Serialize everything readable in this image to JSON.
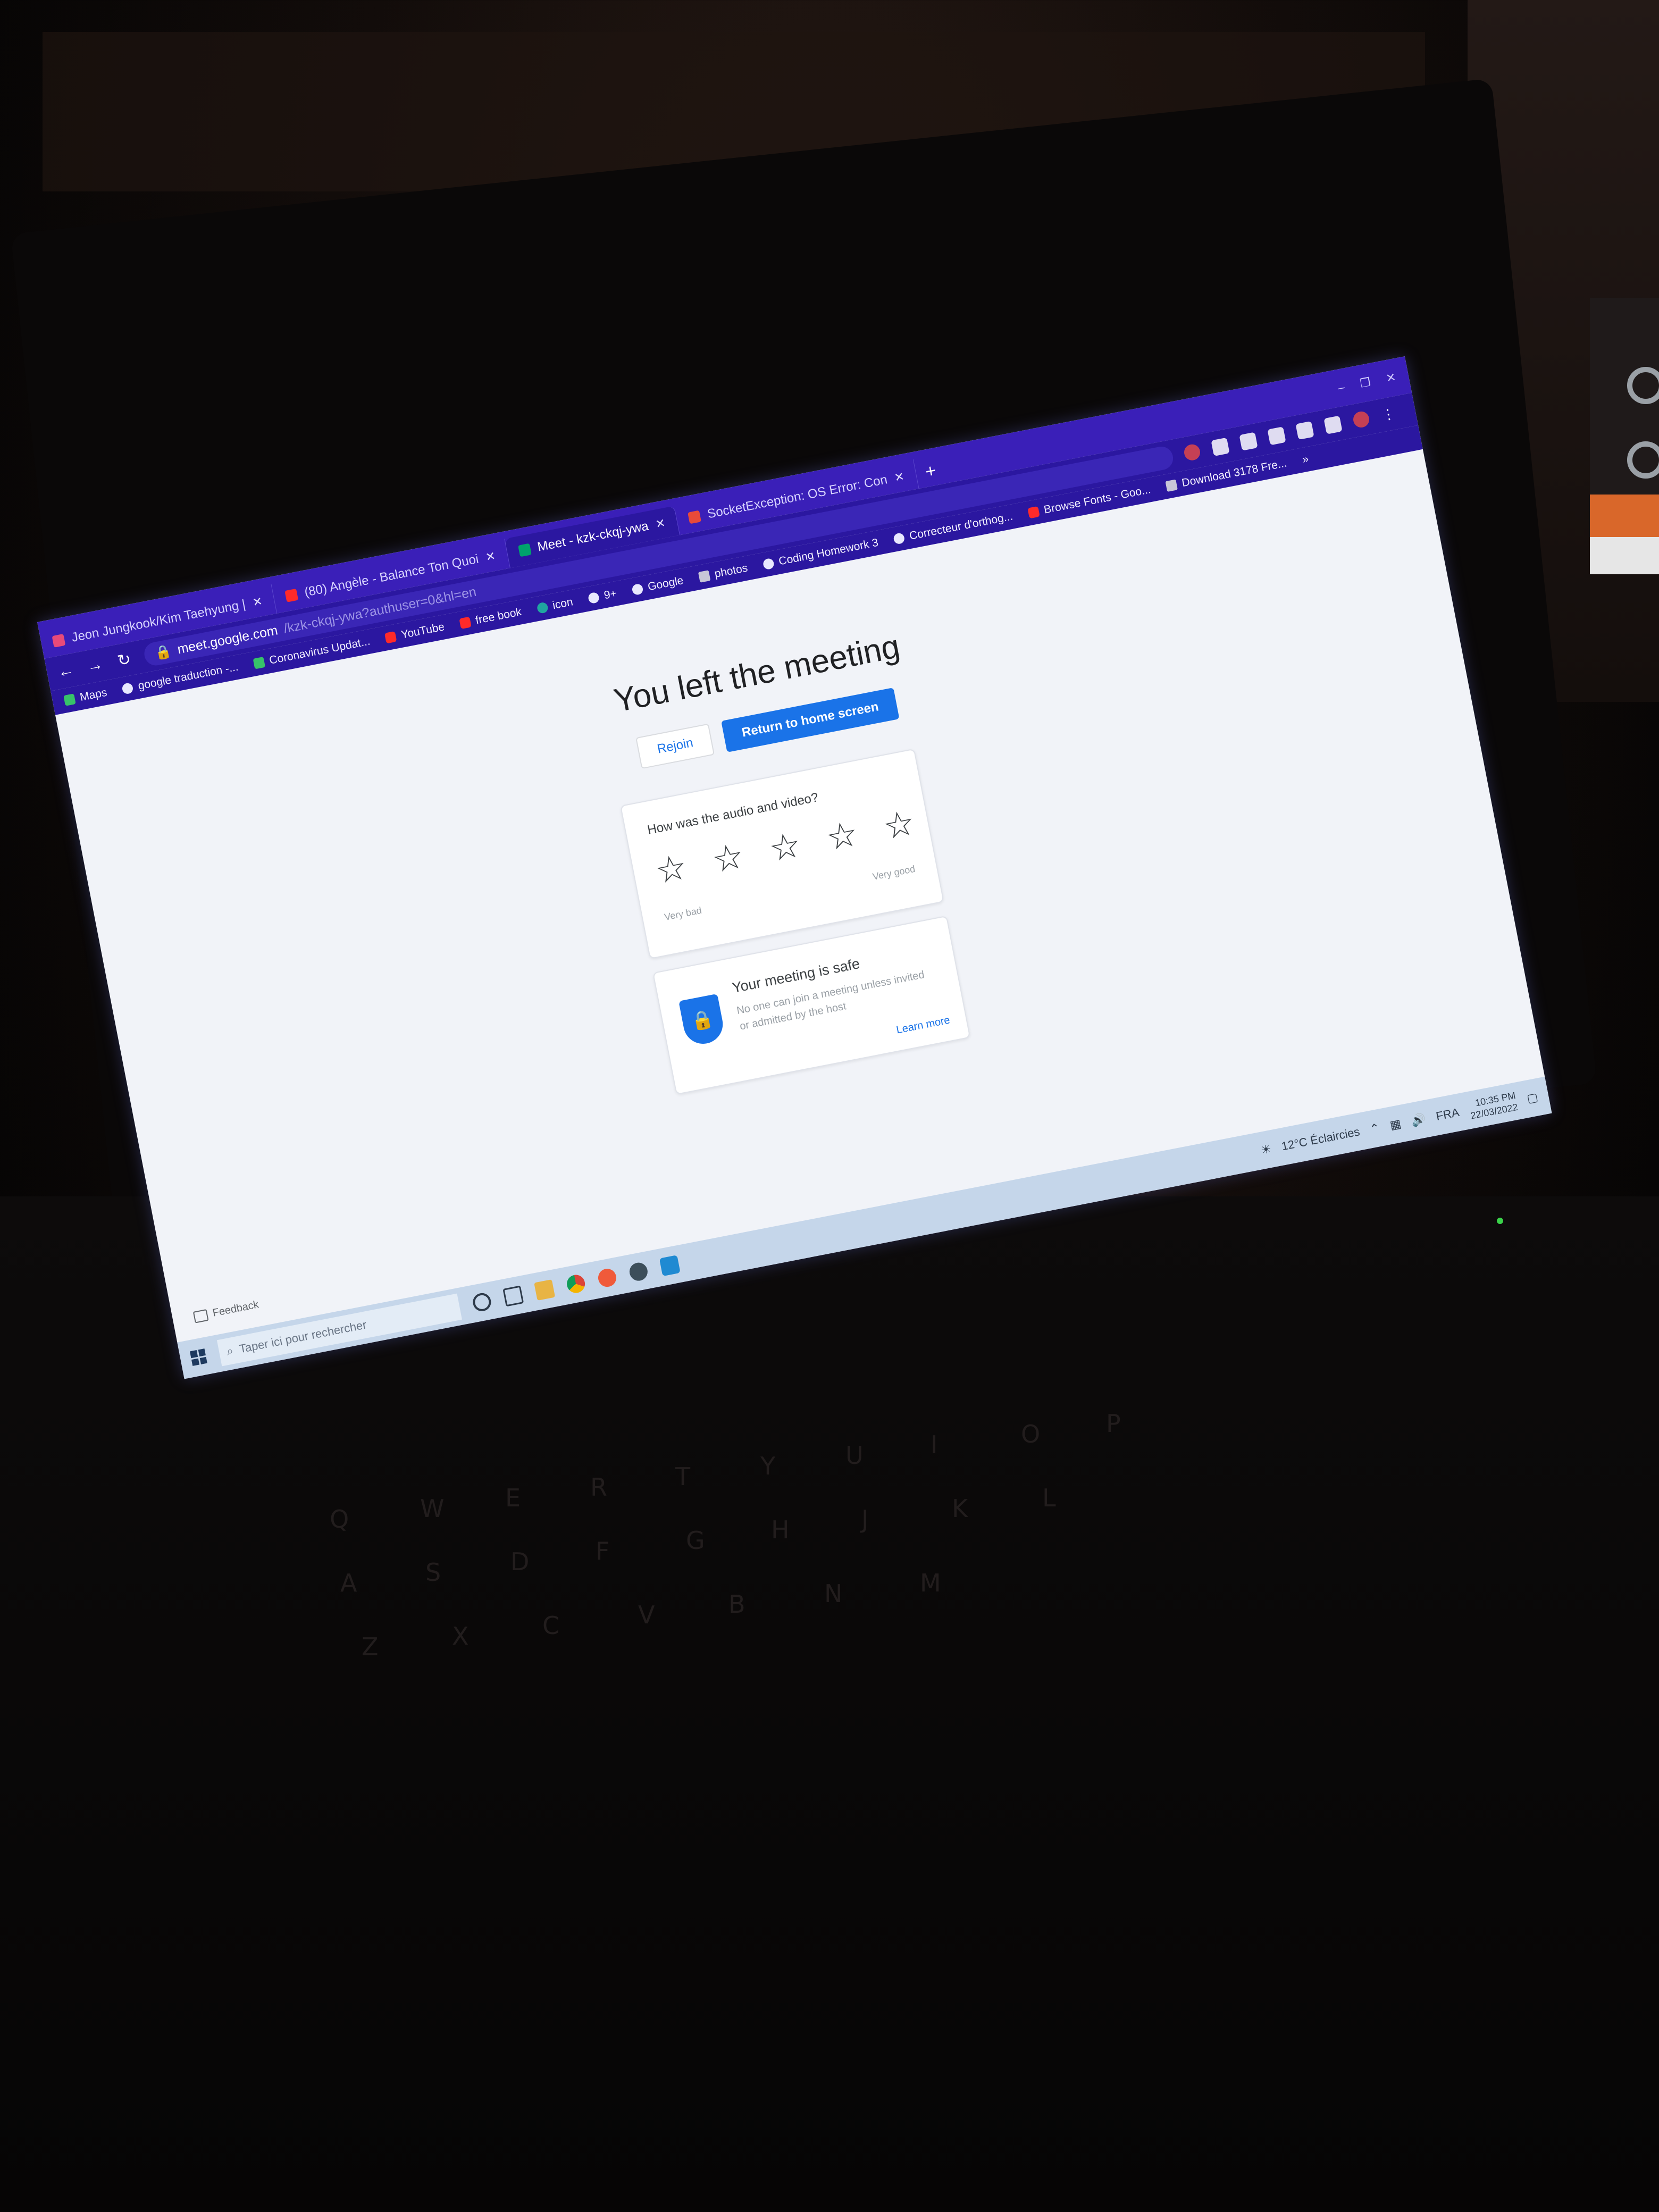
{
  "browser": {
    "tabs": [
      {
        "label": "Jeon Jungkook/Kim Taehyung |",
        "favicon_color": "#e84a7a"
      },
      {
        "label": "(80) Angèle - Balance Ton Quoi",
        "favicon_color": "#ff2a2a"
      },
      {
        "label": "Meet - kzk-ckqj-ywa",
        "favicon_color": "#00a36c",
        "active": true
      },
      {
        "label": "SocketException: OS Error: Con",
        "favicon_color": "#e84a3a"
      }
    ],
    "new_tab_label": "+",
    "window_controls": [
      "–",
      "❐",
      "✕"
    ],
    "address": {
      "host": "meet.google.com",
      "path": "/kzk-ckqj-ywa?authuser=0&hl=en"
    },
    "bookmarks": [
      {
        "label": "Maps",
        "icon": "maps-icon"
      },
      {
        "label": "google traduction -...",
        "icon": "globe-icon"
      },
      {
        "label": "Coronavirus Updat...",
        "icon": "green-box-icon"
      },
      {
        "label": "YouTube",
        "icon": "youtube-icon"
      },
      {
        "label": "free book",
        "icon": "book-icon"
      },
      {
        "label": "icon",
        "icon": "teal-icon"
      },
      {
        "label": "9+",
        "icon": "globe-icon"
      },
      {
        "label": "Google",
        "icon": "google-icon"
      },
      {
        "label": "photos",
        "icon": "folder-icon"
      },
      {
        "label": "Coding Homework 3",
        "icon": "globe-icon"
      },
      {
        "label": "Correcteur d'orthog...",
        "icon": "globe-icon"
      },
      {
        "label": "Browse Fonts - Goo...",
        "icon": "google-fonts-icon"
      },
      {
        "label": "Download 3178 Fre...",
        "icon": "folder-icon"
      }
    ],
    "bookmarks_overflow": "»"
  },
  "meet": {
    "title": "You left the meeting",
    "rejoin_label": "Rejoin",
    "return_label": "Return to home screen",
    "rating": {
      "question": "How was the audio and video?",
      "stars_total": 5,
      "stars_selected": 0,
      "low_label": "Very bad",
      "high_label": "Very good"
    },
    "safety": {
      "title": "Your meeting is safe",
      "text": "No one can join a meeting unless invited or admitted by the host",
      "link": "Learn more"
    },
    "feedback_label": "Feedback"
  },
  "taskbar": {
    "search_placeholder": "Taper ici pour rechercher",
    "weather": "12°C  Éclaircies",
    "language": "FRA",
    "time": "10:35 PM",
    "date": "22/03/2022"
  },
  "colors": {
    "chrome_bg": "#2b17a0",
    "accent_blue": "#1a73e8",
    "page_bg": "#f1f3f8"
  }
}
